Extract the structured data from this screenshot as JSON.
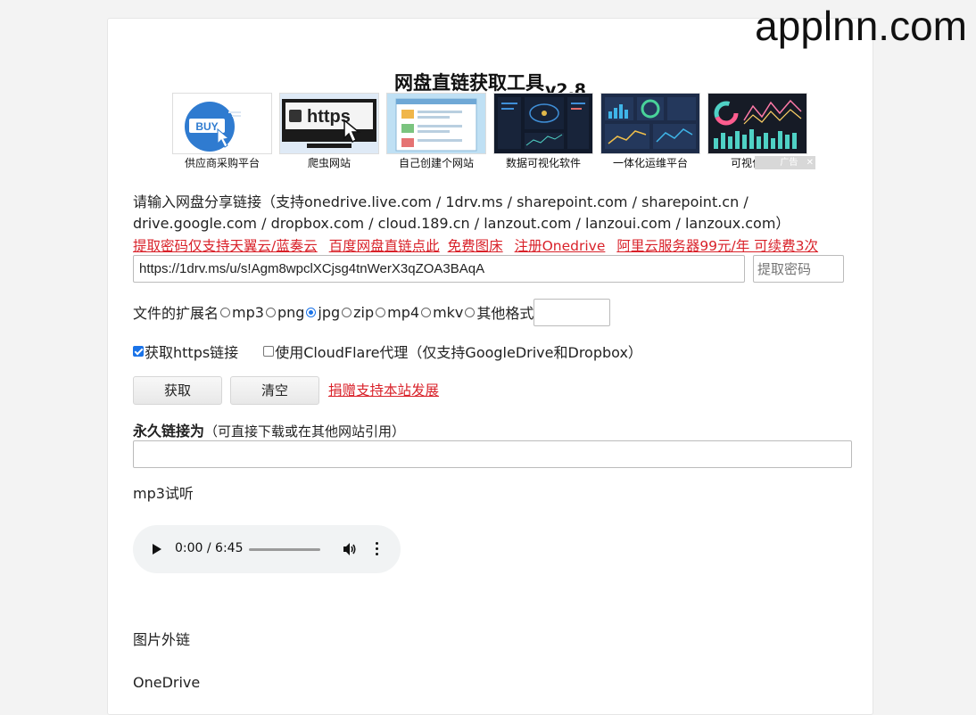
{
  "watermark": "applnn.com",
  "title": {
    "text": "网盘直链获取工具",
    "version": "v2.8"
  },
  "ads": {
    "items": [
      {
        "caption": "供应商采购平台",
        "icon": "buy-icon"
      },
      {
        "caption": "爬虫网站",
        "icon": "https-monitor-icon"
      },
      {
        "caption": "自己创建个网站",
        "icon": "website-builder-icon"
      },
      {
        "caption": "数据可视化软件",
        "icon": "dashboard-icon"
      },
      {
        "caption": "一体化运维平台",
        "icon": "ops-dashboard-icon"
      },
      {
        "caption": "可视化工具",
        "icon": "charts-icon"
      }
    ],
    "flag_label": "广告",
    "flag_close": "✕"
  },
  "form": {
    "prompt_line1": "请输入网盘分享链接（支持onedrive.live.com / 1drv.ms / sharepoint.com / sharepoint.cn /",
    "prompt_line2": "drive.google.com / dropbox.com / cloud.189.cn / lanzout.com / lanzoui.com / lanzoux.com）",
    "links": [
      "提取密码仅支持天翼云/蓝奏云",
      "百度网盘直链点此",
      "免费图床",
      "注册Onedrive",
      "阿里云服务器99元/年 可续费3次"
    ],
    "url_value": "https://1drv.ms/u/s!Agm8wpclXCjsg4tnWerX3qZOA3BAqA",
    "password_placeholder": "提取密码",
    "ext_label": "文件的扩展名",
    "ext_options": [
      "mp3",
      "png",
      "jpg",
      "zip",
      "mp4",
      "mkv",
      "其他格式"
    ],
    "ext_selected": "jpg",
    "https_label": "获取https链接",
    "https_checked": true,
    "cloudflare_label": "使用CloudFlare代理（仅支持GoogleDrive和Dropbox）",
    "cloudflare_checked": false,
    "get_button": "获取",
    "clear_button": "清空",
    "donate_link": "捐赠支持本站发展"
  },
  "result": {
    "perm_title": "永久链接为",
    "perm_note": "（可直接下载或在其他网站引用）",
    "mp3_label": "mp3试听",
    "audio_time": "0:00 / 6:45",
    "image_link_label": "图片外链",
    "onedrive_label": "OneDrive"
  }
}
